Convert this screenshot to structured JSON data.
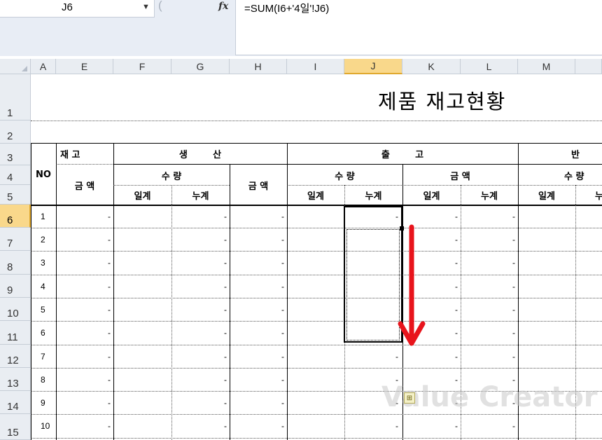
{
  "formula_bar": {
    "name_box": "J6",
    "fx_label": "fx",
    "formula": "=SUM(I6+'4일'!J6)"
  },
  "columns": [
    "A",
    "E",
    "F",
    "G",
    "H",
    "I",
    "J",
    "K",
    "L",
    "M"
  ],
  "rows": [
    "1",
    "2",
    "3",
    "4",
    "5",
    "6",
    "7",
    "8",
    "9",
    "10",
    "11",
    "12",
    "13",
    "14",
    "15"
  ],
  "selected": {
    "column": "J",
    "row": "6"
  },
  "sheet": {
    "title": "제품  재고현황",
    "headers": {
      "no": "NO",
      "stock": "재 고",
      "stock_amount": "금   액",
      "production": "생        산",
      "prod_qty": "수 량",
      "prod_amount": "금 액",
      "daily": "일계",
      "cumulative": "누계",
      "shipment": "출        고",
      "ship_qty": "수 량",
      "ship_amount": "금 액",
      "returns": "반",
      "ret_qty": "수 량",
      "ret_cum_partial": "누"
    },
    "item_numbers": [
      "1",
      "2",
      "3",
      "4",
      "5",
      "6",
      "7",
      "8",
      "9",
      "10"
    ],
    "empty_value": "-"
  },
  "colors": {
    "accent_arrow": "#e8141c",
    "selected_header": "#f9d88b",
    "header_bg": "#e9edf2"
  },
  "watermark": "Value Creator"
}
